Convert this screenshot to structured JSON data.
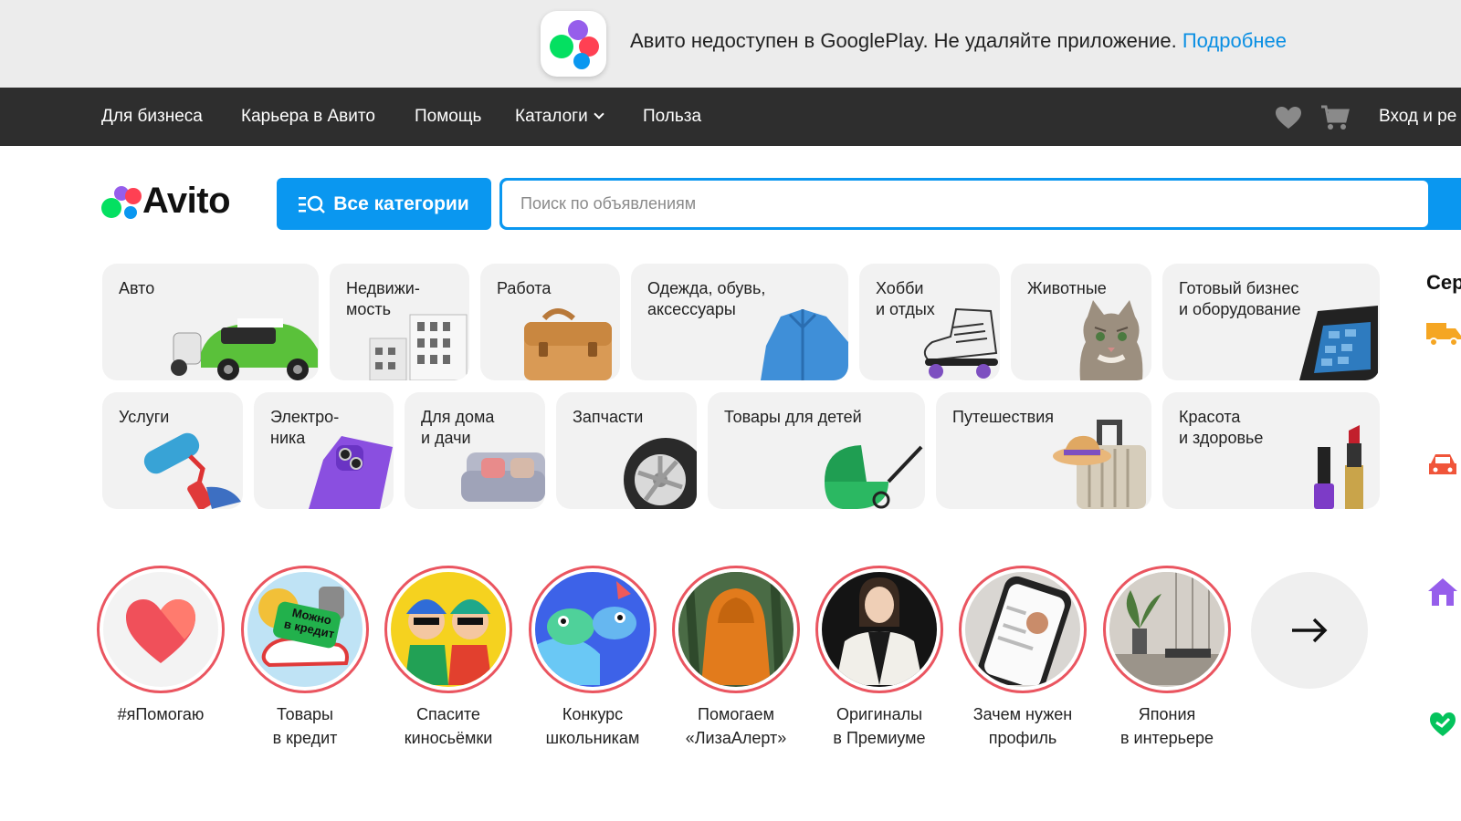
{
  "banner": {
    "message": "Авито недоступен в GooglePlay. Не удаляйте приложение.",
    "link": "Подробнее"
  },
  "topnav": {
    "items": [
      "Для бизнеса",
      "Карьера в Авито",
      "Помощь",
      "Каталоги",
      "Польза"
    ],
    "login": "Вход и ре"
  },
  "header": {
    "logo_text": "Avito",
    "categories_button": "Все категории",
    "search_placeholder": "Поиск по объявлениям"
  },
  "categories": [
    {
      "label": "Авто"
    },
    {
      "label": "Недвижи-\nмость"
    },
    {
      "label": "Работа"
    },
    {
      "label": "Одежда, обувь,\nаксессуары"
    },
    {
      "label": "Хобби\nи отдых"
    },
    {
      "label": "Животные"
    },
    {
      "label": "Готовый бизнес\nи оборудование"
    },
    {
      "label": "Услуги"
    },
    {
      "label": "Электро-\nника"
    },
    {
      "label": "Для дома\nи дачи"
    },
    {
      "label": "Запчасти"
    },
    {
      "label": "Товары для детей"
    },
    {
      "label": "Путешествия"
    },
    {
      "label": "Красота\nи здоровье"
    }
  ],
  "sidebar": {
    "title": "Сер"
  },
  "stories": [
    {
      "label": "#яПомогаю"
    },
    {
      "label": "Товары\nв кредит",
      "badge": "Можно\nв кредит"
    },
    {
      "label": "Спасите\nкиносьёмки"
    },
    {
      "label": "Конкурс\nшкольникам"
    },
    {
      "label": "Помогаем\n«ЛизаАлерт»"
    },
    {
      "label": "Оригиналы\nв Премиуме"
    },
    {
      "label": "Зачем нужен\nпрофиль"
    },
    {
      "label": "Япония\nв интерьере"
    }
  ],
  "colors": {
    "accent": "#0a97f0",
    "nav_bg": "#2e2e2e",
    "story_ring": "#ea5560",
    "link": "#0a8fe3"
  }
}
